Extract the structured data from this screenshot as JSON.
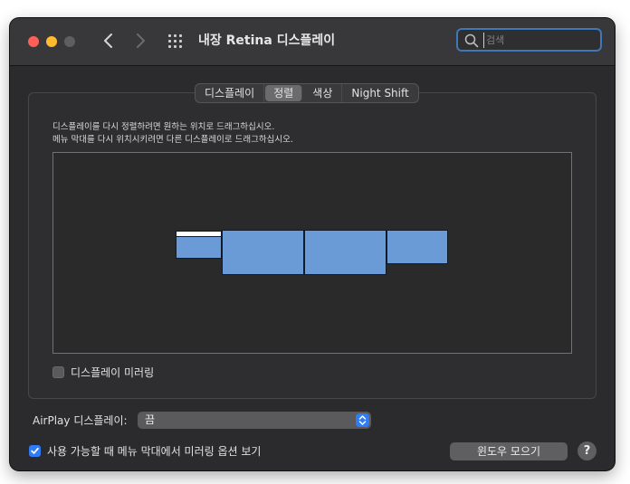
{
  "window": {
    "title": "내장 Retina 디스플레이"
  },
  "toolbar": {
    "back_icon": "chevron-left-icon",
    "forward_icon": "chevron-right-icon",
    "grid_icon": "grid-icon"
  },
  "search": {
    "placeholder": "검색",
    "value": ""
  },
  "tabs": [
    {
      "label": "디스플레이",
      "active": false
    },
    {
      "label": "정렬",
      "active": true
    },
    {
      "label": "색상",
      "active": false
    },
    {
      "label": "Night Shift",
      "active": false
    }
  ],
  "arrangement": {
    "instruction_line1": "디스플레이를 다시 정렬하려면 원하는 위치로 드래그하십시오.",
    "instruction_line2": "메뉴 막대를 다시 위치시키려면 다른 디스플레이로 드래그하십시오.",
    "display_color": "#6b9bd6"
  },
  "mirroring": {
    "label": "디스플레이 미러링",
    "checked": false
  },
  "airplay": {
    "label": "AirPlay 디스플레이:",
    "selected": "끔"
  },
  "menu_bar_option": {
    "label": "사용 가능할 때 메뉴 막대에서 미러링 옵션 보기",
    "checked": true
  },
  "buttons": {
    "gather_windows": "윈도우 모으기",
    "help": "?"
  },
  "colors": {
    "accent": "#2f7cf6",
    "search_focus": "#3f78b8"
  }
}
